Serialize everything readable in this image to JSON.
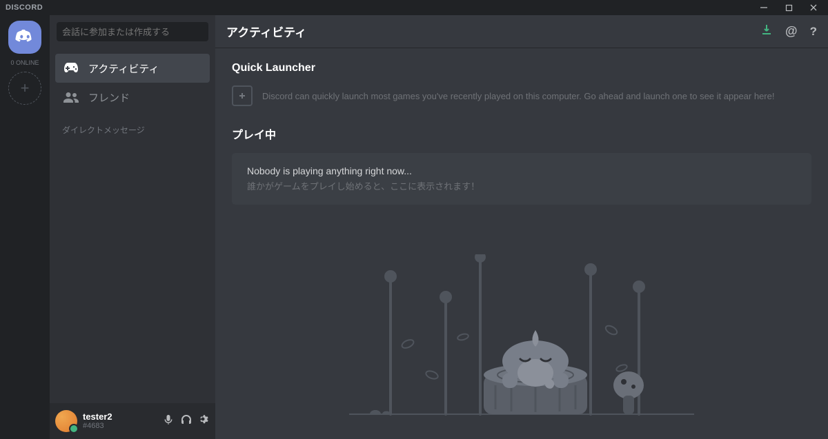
{
  "window": {
    "brand": "DISCORD"
  },
  "guilds": {
    "online_label": "0 ONLINE"
  },
  "sidebar": {
    "search_placeholder": "会話に参加または作成する",
    "nav": {
      "activity": "アクティビティ",
      "friends": "フレンド"
    },
    "dm_header": "ダイレクトメッセージ"
  },
  "user": {
    "name": "tester2",
    "tag": "#4683"
  },
  "header": {
    "title": "アクティビティ"
  },
  "main": {
    "quick_launcher_title": "Quick Launcher",
    "quick_launcher_desc": "Discord can quickly launch most games you've recently played on this computer. Go ahead and launch one to see it appear here!",
    "playing_title": "プレイ中",
    "playing_empty_line1": "Nobody is playing anything right now...",
    "playing_empty_line2": "誰かがゲームをプレイし始めると、ここに表示されます！"
  }
}
